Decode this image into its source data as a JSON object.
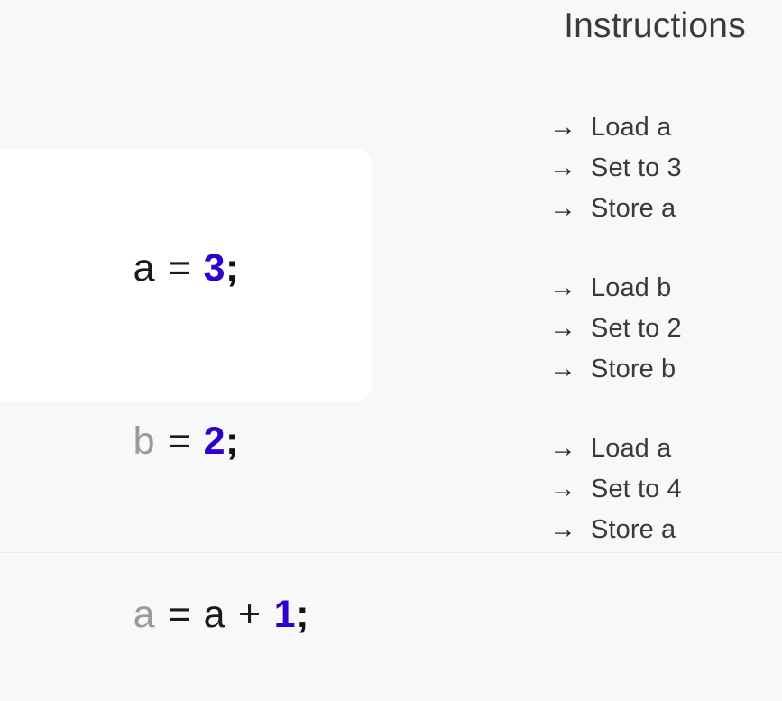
{
  "background": {
    "page_color": "#f8f8f8",
    "card_color": "#ffffff"
  },
  "code_card": {
    "name": "code-snippet",
    "accent_number_color": "#2e00cf",
    "dim_variable_color": "#9a9a9a",
    "lines": [
      {
        "id": "line-1",
        "text": "a = 3;",
        "tokens": [
          {
            "t": "a",
            "k": "var-live"
          },
          {
            "t": "=",
            "k": "op"
          },
          {
            "t": "3",
            "k": "num"
          },
          {
            "t": ";",
            "k": "punct"
          }
        ]
      },
      {
        "id": "line-2",
        "text": "b = 2;",
        "tokens": [
          {
            "t": "b",
            "k": "var-dim"
          },
          {
            "t": "=",
            "k": "op"
          },
          {
            "t": "2",
            "k": "num"
          },
          {
            "t": ";",
            "k": "punct"
          }
        ]
      },
      {
        "id": "line-3",
        "text": "a = a + 1;",
        "tokens": [
          {
            "t": "a",
            "k": "var-dim"
          },
          {
            "t": "=",
            "k": "op"
          },
          {
            "t": "a",
            "k": "var-live"
          },
          {
            "t": "+",
            "k": "op"
          },
          {
            "t": "1",
            "k": "num"
          },
          {
            "t": ";",
            "k": "punct"
          }
        ]
      }
    ]
  },
  "instructions": {
    "title": "Instructions",
    "arrow_glyph": "→",
    "groups": [
      {
        "id": "group-a-set-3",
        "steps": [
          {
            "arrow": "→",
            "label": "Load a"
          },
          {
            "arrow": "→",
            "label": "Set to 3"
          },
          {
            "arrow": "→",
            "label": "Store a"
          }
        ]
      },
      {
        "id": "group-b-set-2",
        "steps": [
          {
            "arrow": "→",
            "label": "Load b"
          },
          {
            "arrow": "→",
            "label": "Set to 2"
          },
          {
            "arrow": "→",
            "label": "Store b"
          }
        ]
      },
      {
        "id": "group-a-set-4",
        "steps": [
          {
            "arrow": "→",
            "label": "Load a"
          },
          {
            "arrow": "→",
            "label": "Set to 4"
          },
          {
            "arrow": "→",
            "label": "Store a"
          }
        ]
      }
    ]
  }
}
